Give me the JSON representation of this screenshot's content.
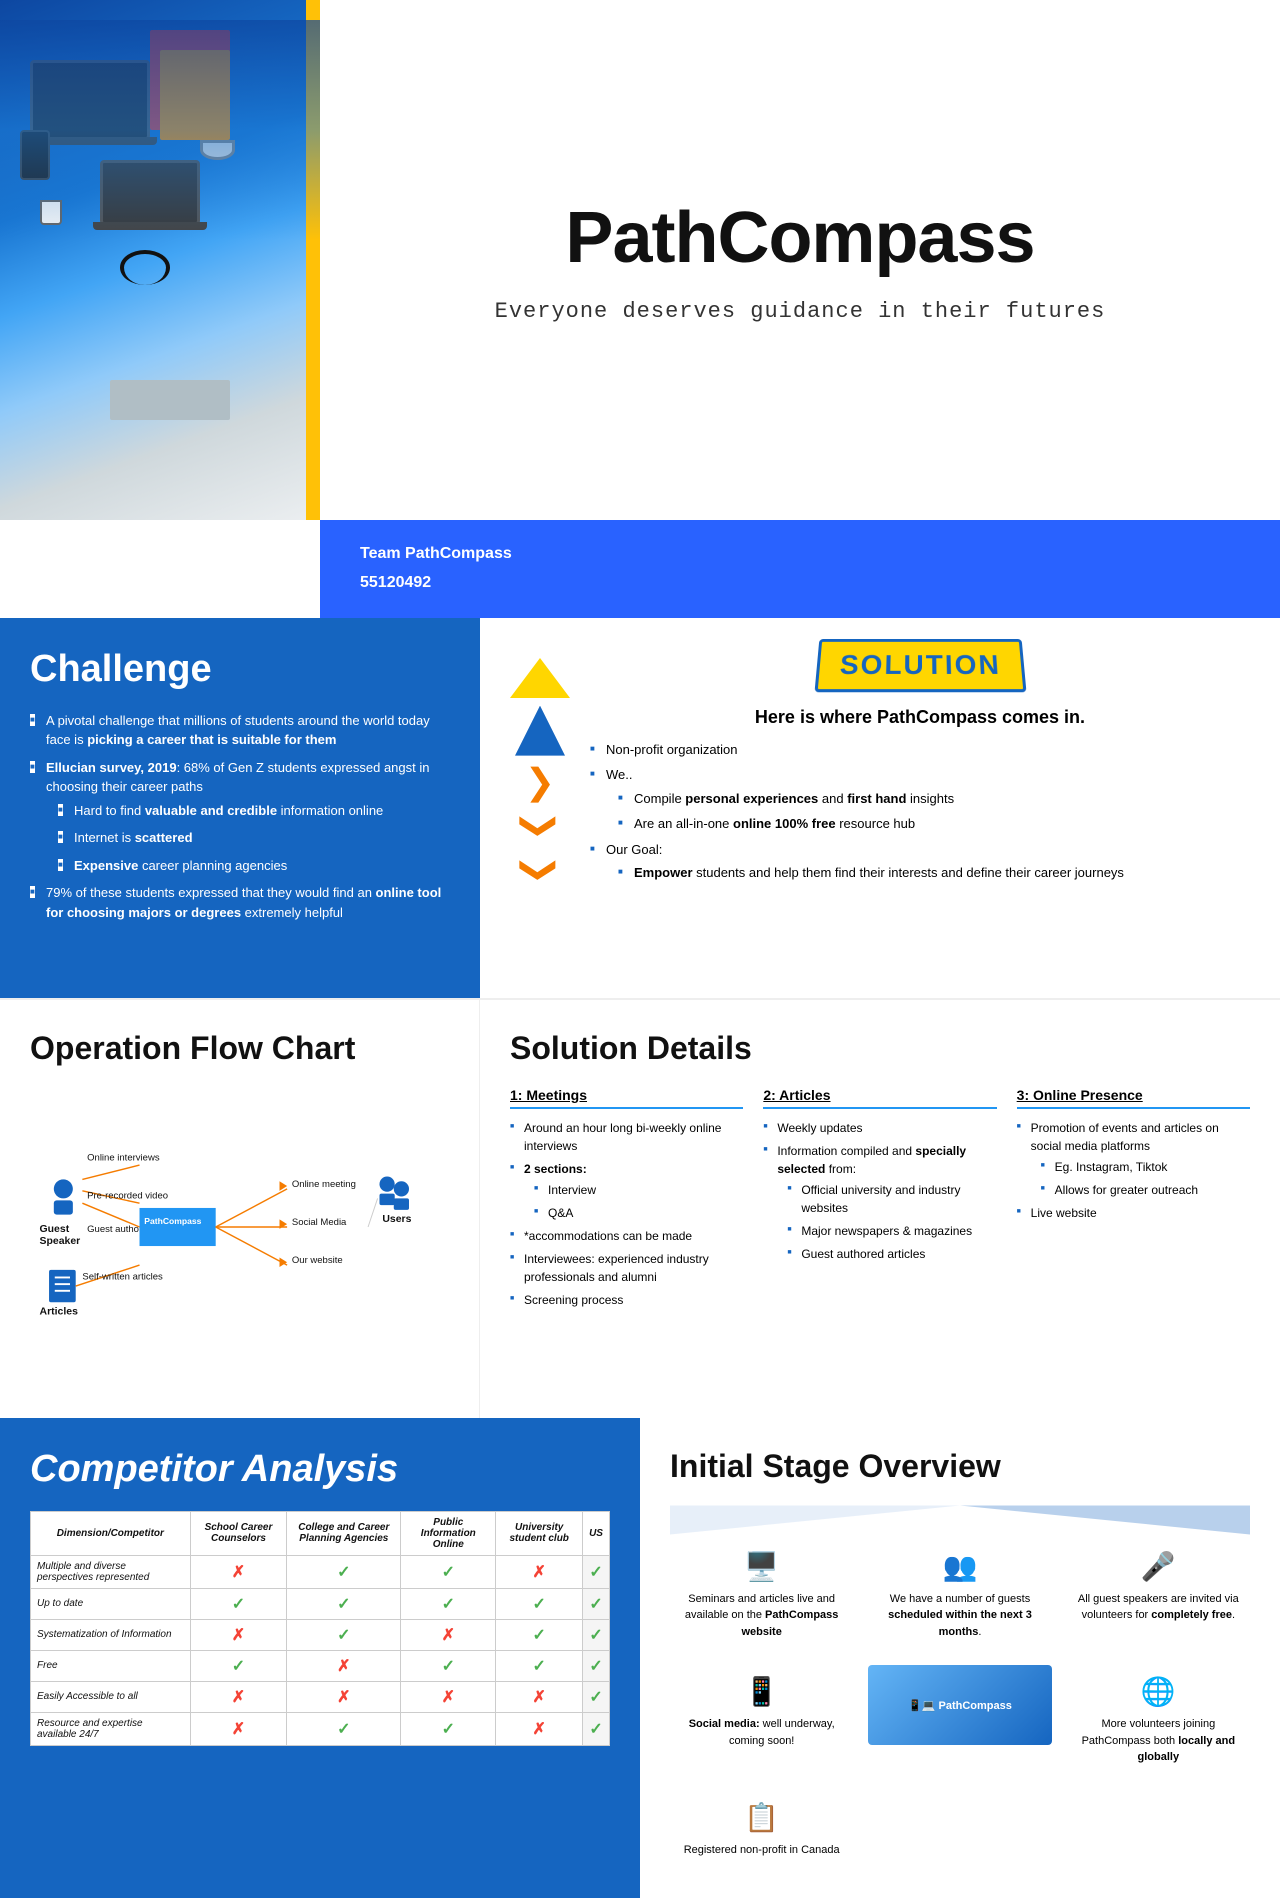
{
  "hero": {
    "title": "PathCompass",
    "subtitle": "Everyone deserves guidance in their futures",
    "team_label": "Team PathCompass",
    "team_id": "55120492"
  },
  "challenge": {
    "heading": "Challenge",
    "points": [
      "A pivotal challenge that millions of students around the world today face is picking a career that is suitable for them",
      "Ellucian survey, 2019: 68% of Gen Z students expressed angst in choosing their career paths",
      "Hard to find valuable and credible information online",
      "Internet is scattered",
      "Expensive career planning agencies",
      "79% of these students expressed that they would find an online tool for choosing majors or degrees extremely helpful"
    ]
  },
  "solution": {
    "badge": "SOLUTION",
    "heading": "Here is where PathCompass comes in.",
    "points": [
      "Non-profit organization",
      "We..",
      "Compile personal experiences and first hand insights",
      "Are an all-in-one online 100% free resource hub",
      "Our Goal:",
      "Empower students and help them find their interests and define their career journeys"
    ]
  },
  "operation_flow": {
    "heading": "Operation Flow Chart",
    "nodes": {
      "guest_speaker": "Guest Speaker",
      "articles": "Articles",
      "pathcompass": "PathCompass",
      "users": "Users",
      "inputs_guest": [
        "Online interviews",
        "Pre-recorded video",
        "Guest authored articles"
      ],
      "inputs_articles": [
        "Self-written articles"
      ],
      "outputs": [
        "Online meeting",
        "Social Media",
        "Our website"
      ]
    }
  },
  "solution_details": {
    "heading": "Solution Details",
    "col1": {
      "title": "1: Meetings",
      "items": [
        "Around an hour long bi-weekly online interviews",
        "2 sections:",
        "Interview",
        "Q&A",
        "*accommodations can be made",
        "Interviewees: experienced industry professionals and alumni",
        "Screening process"
      ]
    },
    "col2": {
      "title": "2: Articles",
      "items": [
        "Weekly updates",
        "Information compiled and specially selected from:",
        "Official university and industry websites",
        "Major newspapers & magazines",
        "Guest authored articles"
      ]
    },
    "col3": {
      "title": "3: Online Presence",
      "items": [
        "Promotion of events and articles on social media platforms",
        "Eg. Instagram, Tiktok",
        "Allows for greater outreach",
        "Live website"
      ]
    }
  },
  "competitor": {
    "heading": "Competitor Analysis",
    "table": {
      "headers": [
        "Dimension/Competitor",
        "School Career Counselors",
        "College and Career Planning Agencies",
        "Public Information Online",
        "University student club",
        "US"
      ],
      "rows": [
        {
          "label": "Multiple and diverse perspectives represented",
          "values": [
            "cross",
            "check",
            "check",
            "cross",
            "check"
          ]
        },
        {
          "label": "Up to date",
          "values": [
            "check",
            "check",
            "check",
            "check",
            "check"
          ]
        },
        {
          "label": "Systematization of Information",
          "values": [
            "cross",
            "check",
            "cross",
            "check",
            "check"
          ]
        },
        {
          "label": "Free",
          "values": [
            "check",
            "cross",
            "check",
            "check",
            "check"
          ]
        },
        {
          "label": "Easily Accessible to all",
          "values": [
            "cross",
            "cross",
            "cross",
            "cross",
            "check"
          ]
        },
        {
          "label": "Resource and expertise available 24/7",
          "values": [
            "cross",
            "check",
            "check",
            "cross",
            "check"
          ]
        }
      ]
    }
  },
  "initial_stage": {
    "heading": "Initial Stage Overview",
    "items": [
      {
        "icon": "🖥",
        "text": "Seminars and articles live and available on the PathCompass website"
      },
      {
        "icon": "👥",
        "text": "We have a number of guests scheduled within the next 3 months."
      },
      {
        "icon": "🎤",
        "text": "All guest speakers are invited via volunteers for completely free."
      },
      {
        "icon": "📱",
        "text": "Social media: well underway, coming soon!"
      },
      {
        "icon": "📋",
        "text": "Registered non-profit in Canada"
      },
      {
        "icon": "🌐",
        "text": "More volunteers joining PathCompass both locally and globally"
      }
    ]
  }
}
